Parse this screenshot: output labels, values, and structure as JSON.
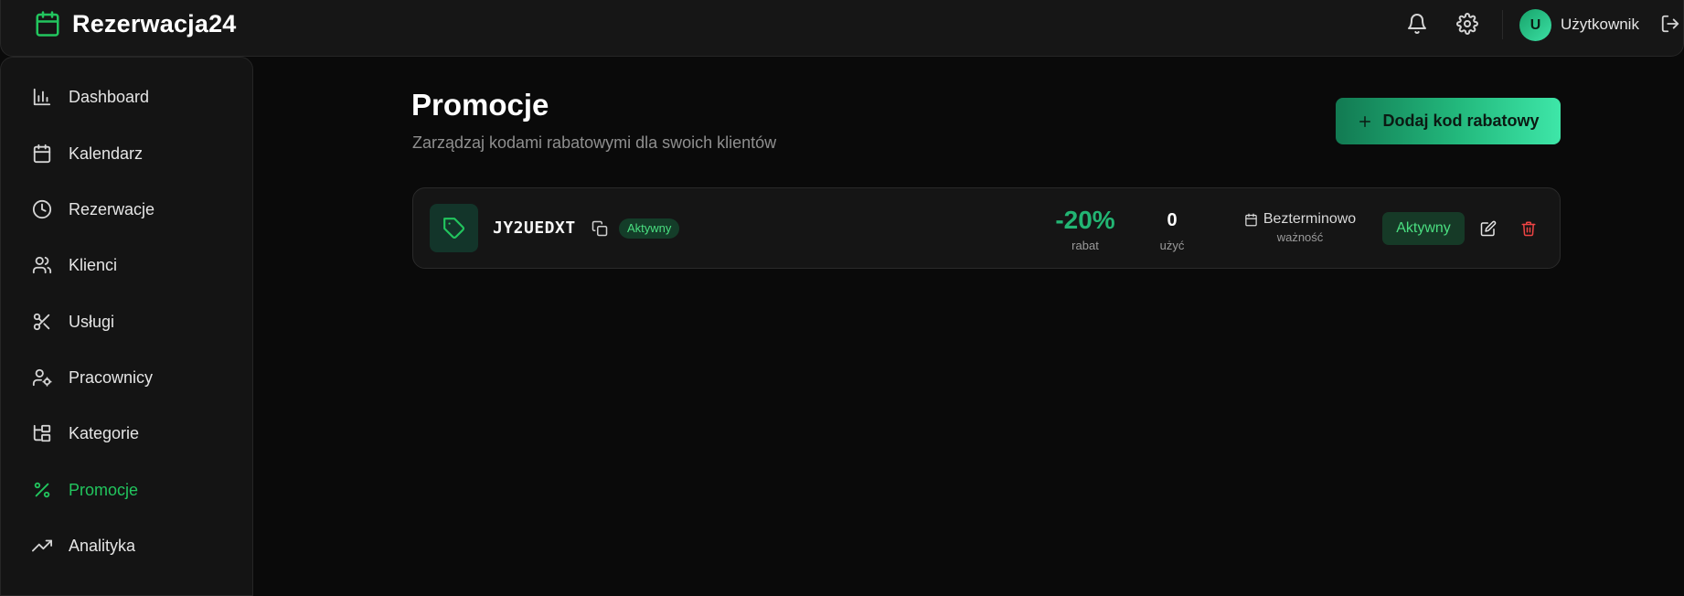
{
  "brand": {
    "name": "Rezerwacja24",
    "icon": "calendar-icon",
    "accent": "#22c55e"
  },
  "header": {
    "notifications_icon": "bell-icon",
    "settings_icon": "gear-icon",
    "avatar_initial": "U",
    "username": "Użytkownik",
    "logout_icon": "logout-icon"
  },
  "sidebar": {
    "items": [
      {
        "label": "Dashboard",
        "icon": "bar-chart-icon"
      },
      {
        "label": "Kalendarz",
        "icon": "calendar-icon"
      },
      {
        "label": "Rezerwacje",
        "icon": "clock-icon"
      },
      {
        "label": "Klienci",
        "icon": "users-icon"
      },
      {
        "label": "Usługi",
        "icon": "scissors-icon"
      },
      {
        "label": "Pracownicy",
        "icon": "user-cog-icon"
      },
      {
        "label": "Kategorie",
        "icon": "folder-tree-icon"
      },
      {
        "label": "Promocje",
        "icon": "percent-icon",
        "active": true
      },
      {
        "label": "Analityka",
        "icon": "trending-up-icon"
      }
    ]
  },
  "main": {
    "title": "Promocje",
    "subtitle": "Zarządzaj kodami rabatowymi dla swoich klientów",
    "add_button": "Dodaj kod rabatowy",
    "promos": [
      {
        "code": "JY2UEDXT",
        "badge": "Aktywny",
        "discount": "-20%",
        "discount_label": "rabat",
        "uses": "0",
        "uses_label": "użyć",
        "validity": "Bezterminowo",
        "validity_label": "ważność",
        "status": "Aktywny"
      }
    ]
  },
  "colors": {
    "background": "#0a0a0a",
    "panel": "#151515",
    "accent_green": "#22c55e",
    "danger": "#ef4444"
  }
}
